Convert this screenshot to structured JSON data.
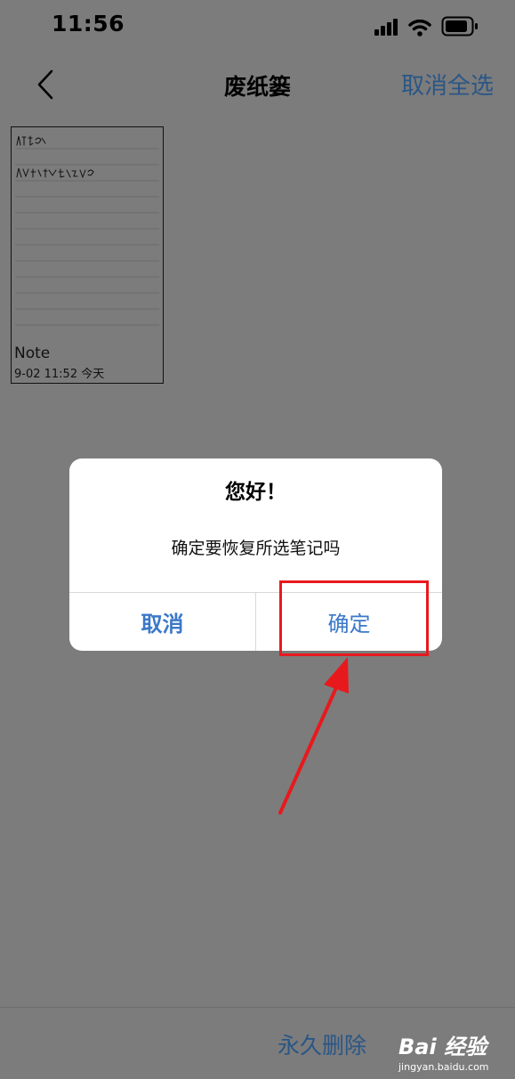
{
  "status_bar": {
    "time": "11:56",
    "icons": [
      "signal-icon",
      "wifi-icon",
      "battery-icon"
    ]
  },
  "nav": {
    "back_icon": "chevron-left-icon",
    "title": "废纸篓",
    "action_label": "取消全选"
  },
  "notes": [
    {
      "title": "Note",
      "meta": "9-02 11:52  今天"
    }
  ],
  "dialog": {
    "title": "您好！",
    "message": "确定要恢复所选笔记吗",
    "cancel_label": "取消",
    "confirm_label": "确定"
  },
  "bottom": {
    "action_label": "永久删除"
  },
  "watermark": {
    "main": "Bai 经验",
    "sub": "jingyan.baidu.com"
  },
  "colors": {
    "overlay_bg": "#7c7c7c",
    "accent_blue": "#3b78c9",
    "dim_blue": "#2a5686",
    "annotation_red": "#e8191d"
  }
}
